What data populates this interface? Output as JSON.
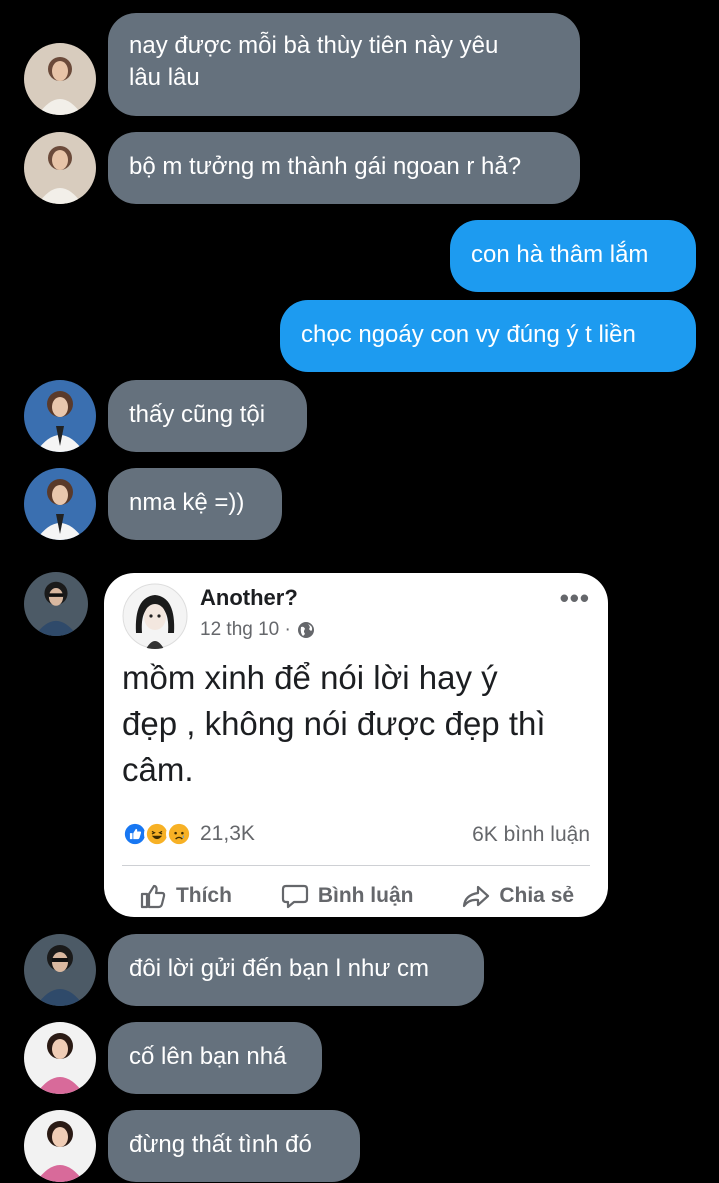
{
  "messages": [
    {
      "text": "nay được mỗi bà thùy tiên này yêu\nlâu lâu"
    },
    {
      "text": "bộ m tưởng m thành gái ngoan r hả?"
    },
    {
      "text": "con hà thâm lắm"
    },
    {
      "text": "chọc ngoáy con vy đúng ý t liền"
    },
    {
      "text": "thấy cũng tội"
    },
    {
      "text": "nma kệ =))"
    },
    {
      "text": "đôi lời gửi đến bạn l như cm"
    },
    {
      "text": "cố lên bạn nhá"
    },
    {
      "text": "đừng thất tình đó"
    }
  ],
  "shared_post": {
    "author": "Another?",
    "date": "12 thg 10 ·",
    "text": "mồm xinh để nói lời hay ý\nđẹp , không nói được đẹp thì\ncâm.",
    "reaction_count": "21,3K",
    "comment_count": "6K bình luận",
    "actions": {
      "like": "Thích",
      "comment": "Bình luận",
      "share": "Chia sẻ"
    },
    "more": "•••"
  },
  "colors": {
    "background": "#000000",
    "incoming_bubble": "#65717d",
    "outgoing_bubble": "#1d9bf0",
    "like_blue": "#1877f2",
    "haha_yellow": "#f7b125"
  }
}
